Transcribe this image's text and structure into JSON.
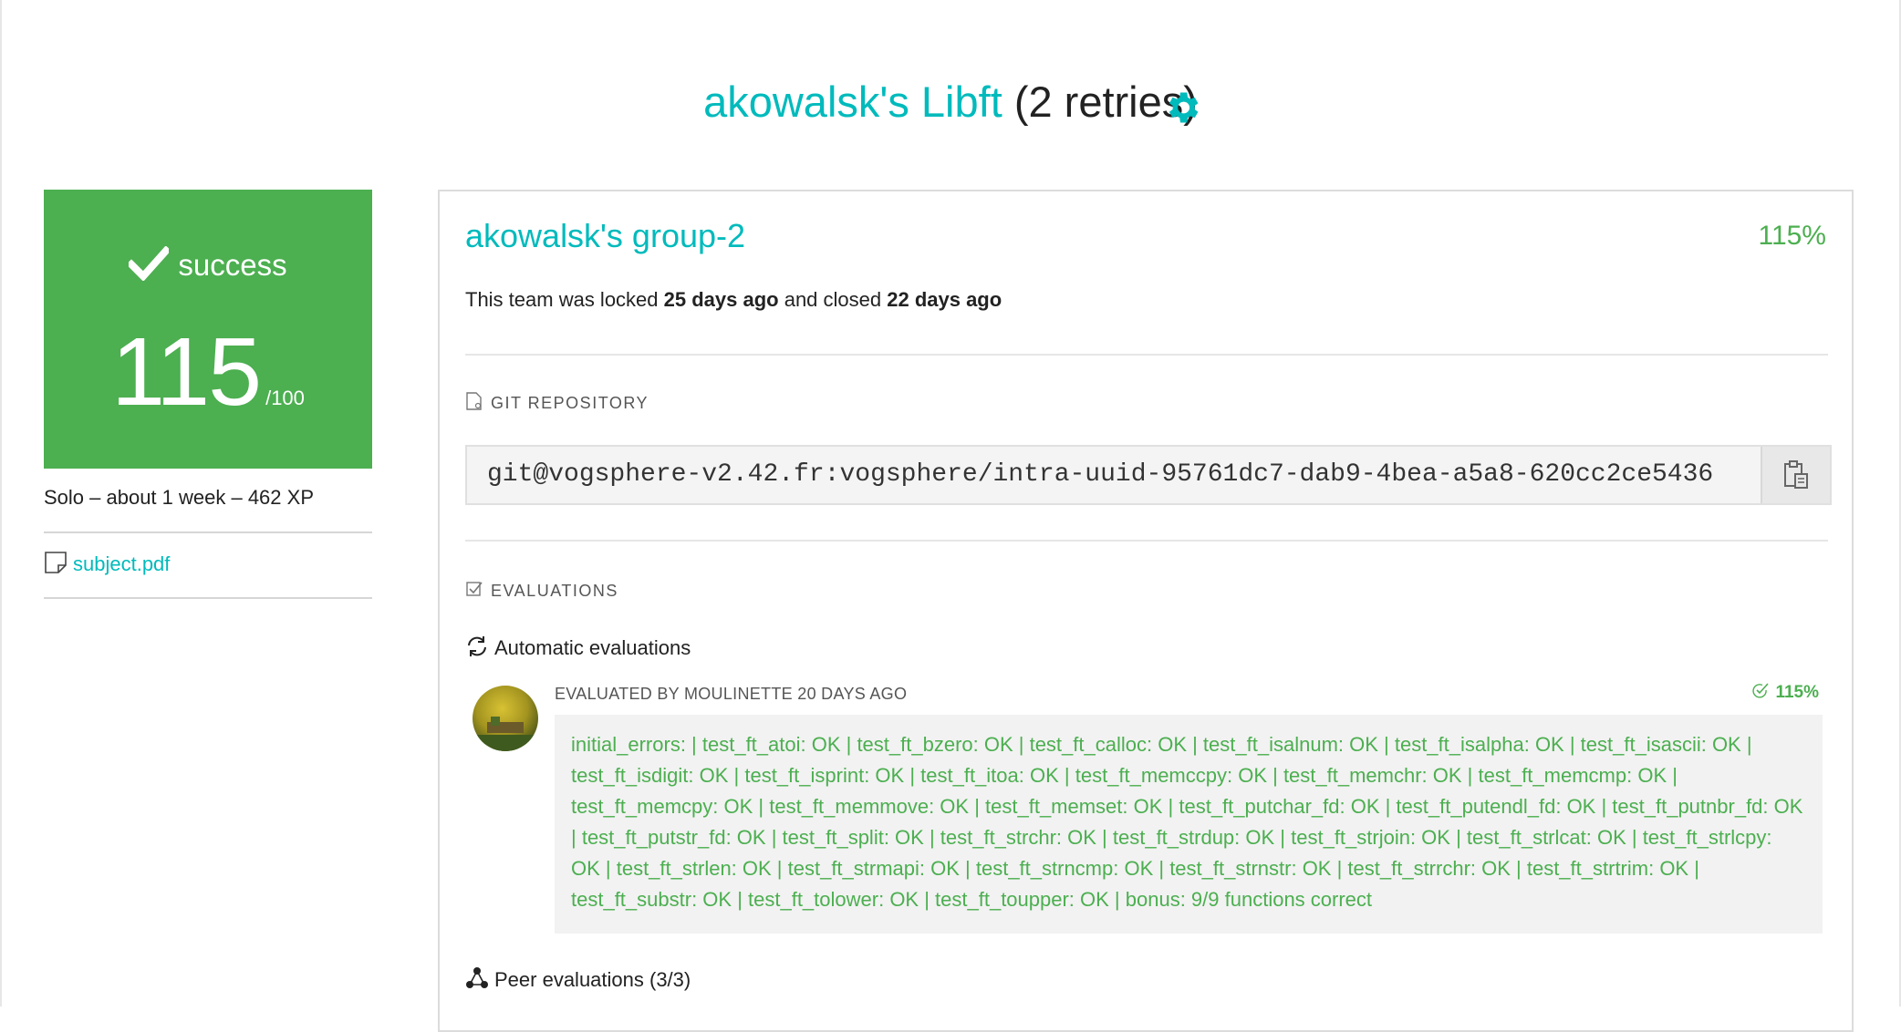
{
  "header": {
    "user_project": "akowalsk's Libft",
    "retries": "(2 retries)",
    "settings_icon": "gear-icon",
    "accent_color": "#00babc"
  },
  "score_card": {
    "status": "success",
    "score": "115",
    "max": "/100",
    "color": "#4caf50"
  },
  "project_meta": {
    "info": "Solo – about 1 week – 462 XP",
    "subject_link": "subject.pdf"
  },
  "team": {
    "name": "akowalsk's group-2",
    "percent": "115%",
    "locked_prefix": "This team was locked ",
    "locked_time": "25 days ago",
    "closed_prefix": " and closed ",
    "closed_time": "22 days ago"
  },
  "repository": {
    "label": "GIT REPOSITORY",
    "url": "git@vogsphere-v2.42.fr:vogsphere/intra-uuid-95761dc7-dab9-4bea-a5a8-620cc2ce5436"
  },
  "evaluations": {
    "label": "EVALUATIONS",
    "automatic_title": "Automatic evaluations",
    "evaluated_by": "EVALUATED BY MOULINETTE 20 DAYS AGO",
    "score": "115%",
    "log": "initial_errors: | test_ft_atoi: OK | test_ft_bzero: OK | test_ft_calloc: OK | test_ft_isalnum: OK | test_ft_isalpha: OK | test_ft_isascii: OK | test_ft_isdigit: OK | test_ft_isprint: OK | test_ft_itoa: OK | test_ft_memccpy: OK | test_ft_memchr: OK | test_ft_memcmp: OK | test_ft_memcpy: OK | test_ft_memmove: OK | test_ft_memset: OK | test_ft_putchar_fd: OK | test_ft_putendl_fd: OK | test_ft_putnbr_fd: OK | test_ft_putstr_fd: OK | test_ft_split: OK | test_ft_strchr: OK | test_ft_strdup: OK | test_ft_strjoin: OK | test_ft_strlcat: OK | test_ft_strlcpy: OK | test_ft_strlen: OK | test_ft_strmapi: OK | test_ft_strncmp: OK | test_ft_strnstr: OK | test_ft_strrchr: OK | test_ft_strtrim: OK | test_ft_substr: OK | test_ft_tolower: OK | test_ft_toupper: OK | bonus: 9/9 functions correct",
    "peer_title": "Peer evaluations (3/3)"
  }
}
